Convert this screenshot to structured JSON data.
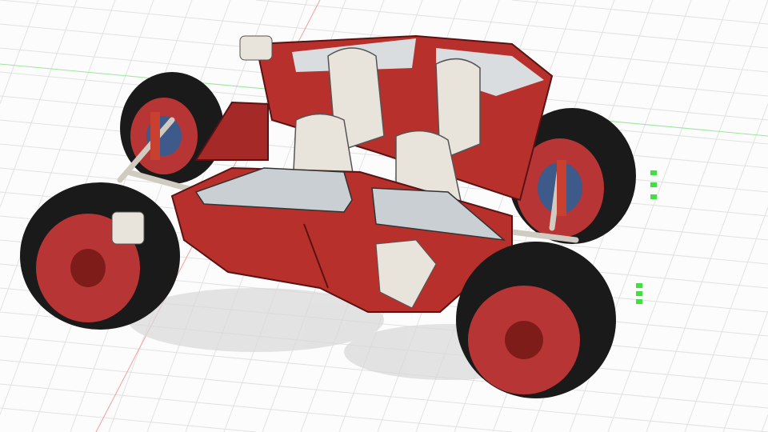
{
  "viewport": {
    "type": "cad-3d-viewport",
    "model": "buggy"
  },
  "colors": {
    "background": "#fcfcfc",
    "grid": "#e2e2e2",
    "axis_x": "#f2a0a0",
    "axis_y": "#9ee59e",
    "body": "#b7302c",
    "body_dark": "#7e1c1a",
    "seat": "#e8e4dc",
    "tire": "#1a1a1a",
    "rim": "#c0393a",
    "brake": "#3d5a8a",
    "glass": "#d9dde0",
    "led": "#3fe03f"
  },
  "icons": [
    "grid-floor",
    "car-model"
  ]
}
